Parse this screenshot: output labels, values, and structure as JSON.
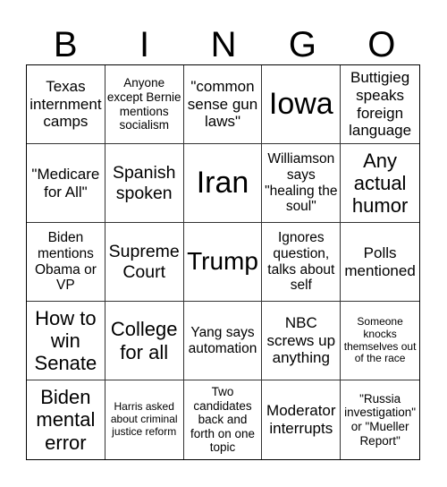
{
  "header": {
    "letters": [
      "B",
      "I",
      "N",
      "G",
      "O"
    ]
  },
  "cells": [
    "Texas internment camps",
    "Anyone except Bernie mentions socialism",
    "\"common sense gun laws\"",
    "Iowa",
    "Buttigieg speaks foreign language",
    "\"Medicare for All\"",
    "Spanish spoken",
    "Iran",
    "Williamson says \"healing the soul\"",
    "Any actual humor",
    "Biden mentions Obama or VP",
    "Supreme Court",
    "Trump",
    "Ignores question, talks about self",
    "Polls mentioned",
    "How to win Senate",
    "College for all",
    "Yang says automation",
    "NBC screws up anything",
    "Someone knocks themselves out of the race",
    "Biden mental error",
    "Harris asked about criminal justice reform",
    "Two candidates back and forth on one topic",
    "Moderator interrupts",
    "\"Russia investigation\" or \"Mueller Report\""
  ]
}
